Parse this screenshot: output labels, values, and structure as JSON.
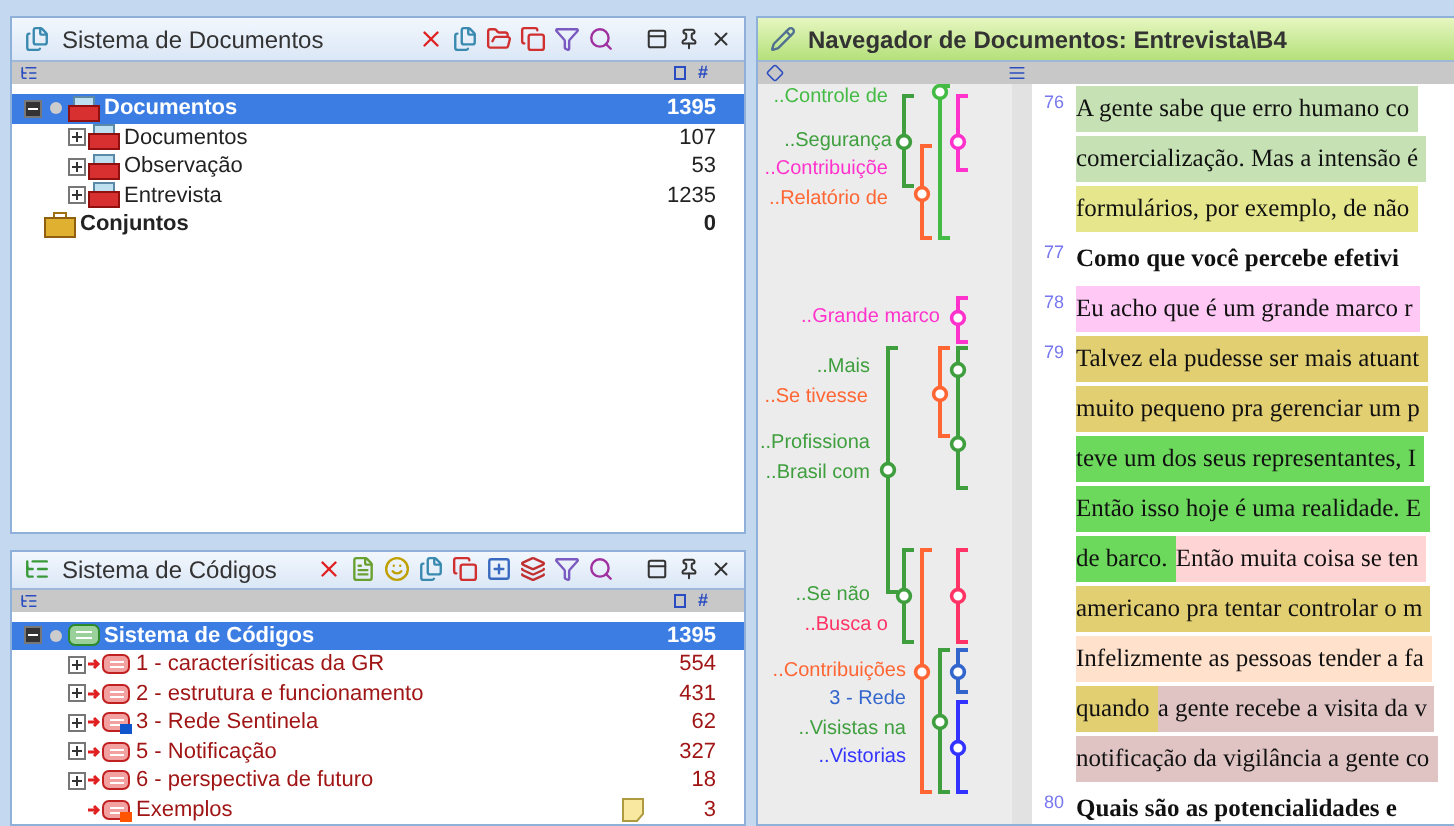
{
  "document_system": {
    "title": "Sistema de Documentos",
    "count_column": "#",
    "tree": [
      {
        "label": "Documentos",
        "count": "1395",
        "kind": "root",
        "selected": true,
        "expanded": true,
        "children": [
          {
            "label": "Documentos",
            "count": "107",
            "kind": "group",
            "selected": false,
            "expanded": false
          },
          {
            "label": "Observação",
            "count": "53",
            "kind": "group",
            "selected": false,
            "expanded": false
          },
          {
            "label": "Entrevista",
            "count": "1235",
            "kind": "group",
            "selected": false,
            "expanded": false
          }
        ]
      },
      {
        "label": "Conjuntos",
        "count": "0",
        "kind": "sets",
        "selected": false
      }
    ]
  },
  "code_system": {
    "title": "Sistema de Códigos",
    "count_column": "#",
    "tree": [
      {
        "label": "Sistema de Códigos",
        "count": "1395",
        "kind": "root",
        "selected": true,
        "expanded": true,
        "children": [
          {
            "label": "1 - caracterísiticas da GR",
            "count": "554",
            "kind": "code",
            "selected": false,
            "expanded": false
          },
          {
            "label": "2 - estrutura e funcionamento",
            "count": "431",
            "kind": "code",
            "selected": false,
            "expanded": false
          },
          {
            "label": "3 - Rede Sentinela",
            "count": "62",
            "kind": "code",
            "selected": false,
            "expanded": false,
            "color": "#1155cc"
          },
          {
            "label": "5 - Notificação",
            "count": "327",
            "kind": "code",
            "selected": false,
            "expanded": false
          },
          {
            "label": "6 - perspectiva de futuro",
            "count": "18",
            "kind": "code",
            "selected": false,
            "expanded": false
          },
          {
            "label": "Exemplos",
            "count": "3",
            "kind": "code",
            "selected": false,
            "memo": true,
            "color": "#ff5500"
          }
        ]
      }
    ]
  },
  "document_browser": {
    "title": "Navegador de Documentos: Entrevista\\B4",
    "codes": [
      {
        "label": "..Controle de",
        "color": "#44bb44"
      },
      {
        "label": "..Segurança",
        "color": "#3f9f3f"
      },
      {
        "label": "..Contribuiçõe",
        "color": "#ff33cc"
      },
      {
        "label": "..Relatório de",
        "color": "#ff6633"
      },
      {
        "label": "..Grande marco",
        "color": "#ff33cc"
      },
      {
        "label": "..Mais",
        "color": "#3f9f3f"
      },
      {
        "label": "..Se tivesse",
        "color": "#ff6633"
      },
      {
        "label": "..Profissiona",
        "color": "#3f9f3f"
      },
      {
        "label": "..Brasil com",
        "color": "#3f9f3f"
      },
      {
        "label": "..Se não",
        "color": "#3f9f3f"
      },
      {
        "label": "..Busca o",
        "color": "#ff3366"
      },
      {
        "label": "..Contribuições",
        "color": "#ff6633"
      },
      {
        "label": "3 - Rede",
        "color": "#3366cc"
      },
      {
        "label": "..Visistas na",
        "color": "#3f9f3f"
      },
      {
        "label": "..Vistorias",
        "color": "#3333ff"
      }
    ],
    "paragraphs": [
      {
        "number": "76",
        "bold": false,
        "lines": [
          [
            {
              "text": "A gente sabe que erro humano co",
              "color": "#c6e2b4"
            }
          ],
          [
            {
              "text": "comercialização. Mas a intensão é",
              "color": "#c6e2b4"
            }
          ],
          [
            {
              "text": "formulários, por exemplo, de não",
              "color": "#e6e68c"
            }
          ]
        ]
      },
      {
        "number": "77",
        "bold": true,
        "lines": [
          [
            {
              "text": "Como que você percebe efetivi",
              "color": "#ffffff"
            }
          ]
        ]
      },
      {
        "number": "78",
        "bold": false,
        "lines": [
          [
            {
              "text": "Eu acho que é um grande marco r",
              "color": "#ffc8f5"
            }
          ]
        ]
      },
      {
        "number": "79",
        "bold": false,
        "lines": [
          [
            {
              "text": "Talvez ela pudesse ser mais atuant",
              "color": "#e2cf72"
            }
          ],
          [
            {
              "text": "muito pequeno pra gerenciar um p",
              "color": "#e2cf72"
            }
          ],
          [
            {
              "text": "teve um dos seus representantes, I",
              "color": "#6cd95c"
            }
          ],
          [
            {
              "text": "Então isso hoje é uma realidade. E",
              "color": "#6cd95c"
            }
          ],
          [
            {
              "text": "de barco.",
              "color": "#6cd95c"
            },
            {
              "text": "Então muita coisa se ten",
              "color": "#ffd4d4"
            }
          ],
          [
            {
              "text": "americano pra tentar controlar o m",
              "color": "#e2cf72"
            }
          ],
          [
            {
              "text": "Infelizmente as pessoas tender a fa",
              "color": "#ffe1cc"
            }
          ],
          [
            {
              "text": "quando",
              "color": "#e2cf72"
            },
            {
              "text": "a gente recebe a visita da v",
              "color": "#e0c4c4"
            }
          ],
          [
            {
              "text": "notificação da vigilância a gente co",
              "color": "#e0c4c4"
            }
          ]
        ]
      },
      {
        "number": "80",
        "bold": true,
        "lines": [
          [
            {
              "text": "Quais são as potencialidades e",
              "color": "#ffffff"
            }
          ]
        ]
      }
    ]
  }
}
